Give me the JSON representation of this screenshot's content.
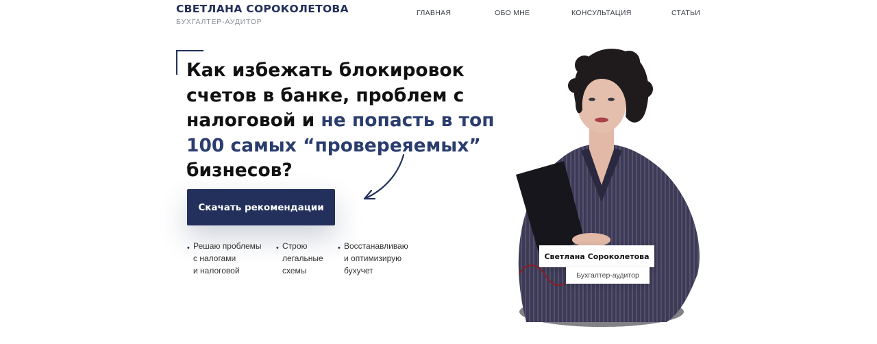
{
  "header": {
    "brand_name": "СВЕТЛАНА СОРОКОЛЕТОВА",
    "brand_subtitle": "БУХГАЛТЕР-АУДИТОР",
    "nav": [
      "ГЛАВНАЯ",
      "ОБО МНЕ",
      "КОНСУЛЬТАЦИЯ",
      "СТАТЬИ"
    ]
  },
  "hero": {
    "headline_lines": [
      [
        "Как избежать блокировок"
      ],
      [
        "счетов в банке, проблем с"
      ],
      [
        "налоговой и ",
        "не попасть в топ"
      ],
      [
        "100 самых “провереяемых”"
      ],
      [
        "бизнесов?"
      ]
    ],
    "cta_label": "Скачать рекомендации",
    "bullets": [
      [
        "Решаю проблемы",
        "с налогами",
        "и налоговой"
      ],
      [
        "Строю",
        "легальные",
        "схемы"
      ],
      [
        "Восстанавливаю",
        "и оптимизирую",
        "бухучет"
      ]
    ]
  },
  "portrait": {
    "name": "Светлана Сороколетова",
    "role": "Бухгалтер-аудитор"
  },
  "colors": {
    "accent": "#22305b",
    "headline_accent": "#2a3d6e",
    "suit": "#3c3a55"
  }
}
